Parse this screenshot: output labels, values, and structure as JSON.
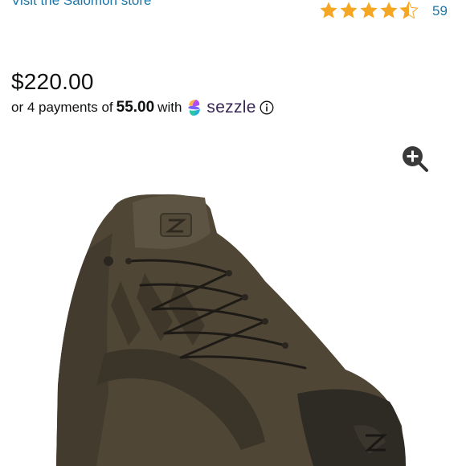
{
  "store": {
    "link_text": "Visit the Salomon store"
  },
  "rating": {
    "stars": 4.5,
    "max_stars": 5,
    "review_count": "59"
  },
  "price": {
    "amount": "$220.00"
  },
  "installments": {
    "prefix": "or 4 payments of",
    "amount": "55.00",
    "with": "with",
    "provider": "sezzle"
  },
  "icons": {
    "zoom": "zoom-in-icon",
    "info": "info-icon",
    "star": "star-icon",
    "provider_logo": "sezzle-logo-icon"
  },
  "colors": {
    "link": "#1a76a8",
    "star": "#f5a623",
    "text": "#0f1111",
    "sezzle_text": "#382757",
    "boot": "#4f4636"
  }
}
